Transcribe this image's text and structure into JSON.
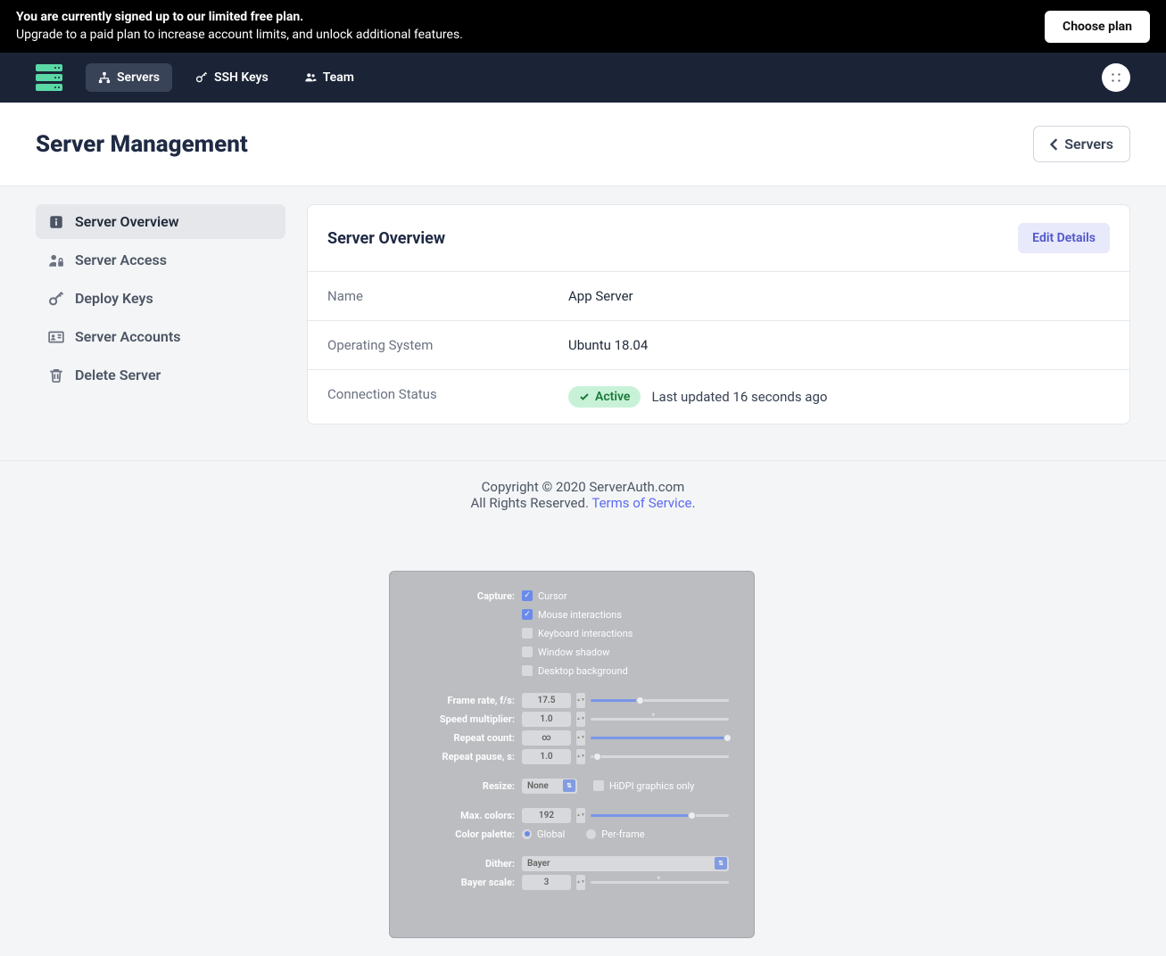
{
  "banner": {
    "line1": "You are currently signed up to our limited free plan.",
    "line2": "Upgrade to a paid plan to increase account limits, and unlock additional features.",
    "button": "Choose plan"
  },
  "nav": {
    "items": [
      {
        "label": "Servers"
      },
      {
        "label": "SSH Keys"
      },
      {
        "label": "Team"
      }
    ]
  },
  "page": {
    "title": "Server Management",
    "back": "Servers"
  },
  "sidenav": {
    "items": [
      {
        "label": "Server Overview"
      },
      {
        "label": "Server Access"
      },
      {
        "label": "Deploy Keys"
      },
      {
        "label": "Server Accounts"
      },
      {
        "label": "Delete Server"
      }
    ]
  },
  "panel": {
    "title": "Server Overview",
    "edit": "Edit Details",
    "rows": {
      "name_label": "Name",
      "name_value": "App Server",
      "os_label": "Operating System",
      "os_value": "Ubuntu 18.04",
      "conn_label": "Connection Status",
      "conn_badge": "Active",
      "conn_updated": "Last updated 16 seconds ago"
    }
  },
  "footer": {
    "copyright": "Copyright © 2020 ServerAuth.com",
    "rights": "All Rights Reserved. ",
    "tos": "Terms of Service",
    "dot": "."
  },
  "ghost": {
    "capture_label": "Capture:",
    "capture_opts": [
      "Cursor",
      "Mouse interactions",
      "Keyboard interactions",
      "Window shadow",
      "Desktop background"
    ],
    "framerate_label": "Frame rate, f/s:",
    "framerate_value": "17.5",
    "speed_label": "Speed multiplier:",
    "speed_value": "1.0",
    "repeat_label": "Repeat count:",
    "repeat_value": "∞",
    "pause_label": "Repeat pause, s:",
    "pause_value": "1.0",
    "resize_label": "Resize:",
    "resize_value": "None",
    "hidpi": "HiDPI graphics only",
    "maxcolors_label": "Max. colors:",
    "maxcolors_value": "192",
    "palette_label": "Color palette:",
    "palette_opts": [
      "Global",
      "Per-frame"
    ],
    "dither_label": "Dither:",
    "dither_value": "Bayer",
    "bayer_label": "Bayer scale:",
    "bayer_value": "3"
  }
}
